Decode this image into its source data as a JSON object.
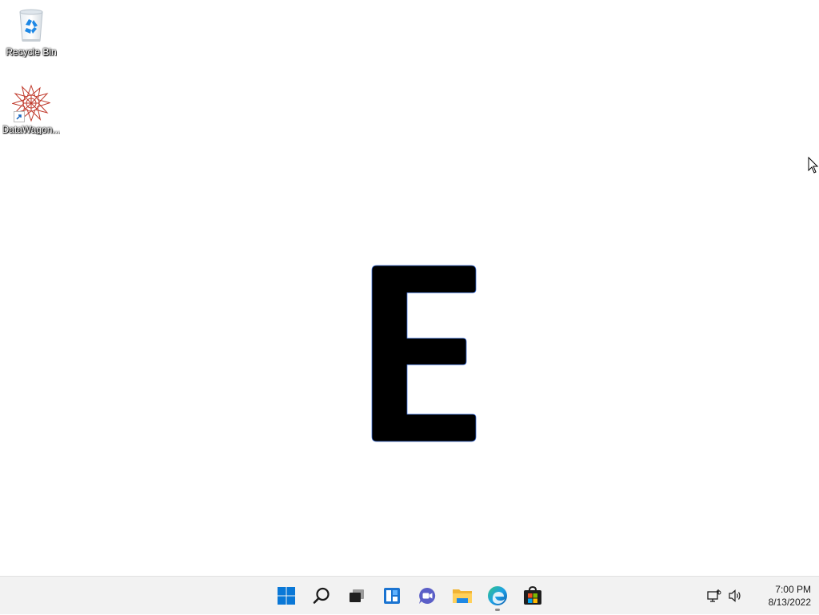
{
  "desktop": {
    "background": "#ffffff",
    "icons": [
      {
        "label": "Recycle Bin",
        "icon": "recycle-bin-icon"
      },
      {
        "label": "DataWagon...",
        "icon": "datawagon-icon"
      }
    ],
    "center_glyph": {
      "text": "E",
      "color": "#000000"
    }
  },
  "taskbar": {
    "background": "#f2f2f2",
    "apps": [
      {
        "name": "Start",
        "icon": "windows-start-icon",
        "running": false
      },
      {
        "name": "Search",
        "icon": "search-icon",
        "running": false
      },
      {
        "name": "Task View",
        "icon": "task-view-icon",
        "running": false
      },
      {
        "name": "Widgets",
        "icon": "widgets-icon",
        "running": false
      },
      {
        "name": "Chat",
        "icon": "chat-icon",
        "running": false
      },
      {
        "name": "File Explorer",
        "icon": "file-explorer-icon",
        "running": false
      },
      {
        "name": "Microsoft Edge",
        "icon": "edge-icon",
        "running": true
      },
      {
        "name": "Microsoft Store",
        "icon": "store-icon",
        "running": false
      }
    ],
    "tray": {
      "icons": [
        "network-icon",
        "volume-icon"
      ],
      "time": "7:00 PM",
      "date": "8/13/2022"
    }
  }
}
